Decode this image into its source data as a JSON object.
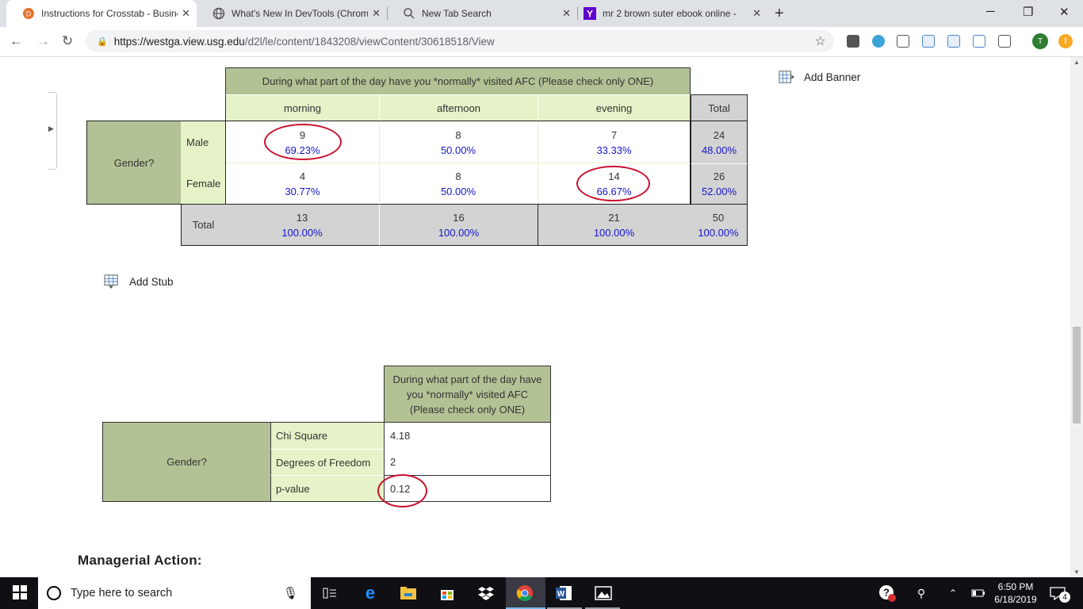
{
  "browser": {
    "tabs": [
      {
        "title": "Instructions for Crosstab - Busine",
        "icon": "d2l-icon",
        "active": true
      },
      {
        "title": "What's New In DevTools (Chrome",
        "icon": "globe-icon",
        "active": false
      },
      {
        "title": "New Tab Search",
        "icon": "search-icon",
        "active": false
      },
      {
        "title": "mr 2 brown suter ebook online -",
        "icon": "yahoo-icon",
        "active": false
      }
    ],
    "url_host": "https://westga.view.usg.edu",
    "url_path": "/d2l/le/content/1843208/viewContent/30618518/View",
    "profile_initial": "T"
  },
  "crosstab": {
    "banner_question": "During what part of the day have you *normally* visited AFC (Please check only ONE)",
    "columns": [
      "morning",
      "afternoon",
      "evening",
      "Total"
    ],
    "stub_label": "Gender?",
    "rows": [
      {
        "label": "Male",
        "counts": [
          "9",
          "8",
          "7",
          "24"
        ],
        "percents": [
          "69.23%",
          "50.00%",
          "33.33%",
          "48.00%"
        ]
      },
      {
        "label": "Female",
        "counts": [
          "4",
          "8",
          "14",
          "26"
        ],
        "percents": [
          "30.77%",
          "50.00%",
          "66.67%",
          "52.00%"
        ]
      }
    ],
    "total_row": {
      "label": "Total",
      "counts": [
        "13",
        "16",
        "21",
        "50"
      ],
      "percents": [
        "100.00%",
        "100.00%",
        "100.00%",
        "100.00%"
      ]
    },
    "add_banner_label": "Add Banner",
    "add_stub_label": "Add Stub"
  },
  "chi_table": {
    "header": "During what part of the day have you *normally* visited AFC (Please check only ONE)",
    "stub_label": "Gender?",
    "rows": [
      {
        "label": "Chi Square",
        "value": "4.18"
      },
      {
        "label": "Degrees of Freedom",
        "value": "2"
      },
      {
        "label": "p-value",
        "value": "0.12"
      }
    ]
  },
  "section_heading": "Managerial Action:",
  "taskbar": {
    "search_placeholder": "Type here to search",
    "time": "6:50 PM",
    "date": "6/18/2019",
    "notification_count": "4"
  },
  "colors": {
    "olive": "#b3c295",
    "lime": "#e6f2c8",
    "gray": "#d3d3d3",
    "percent_blue": "#1515c8",
    "circle_red": "#c8102e"
  }
}
